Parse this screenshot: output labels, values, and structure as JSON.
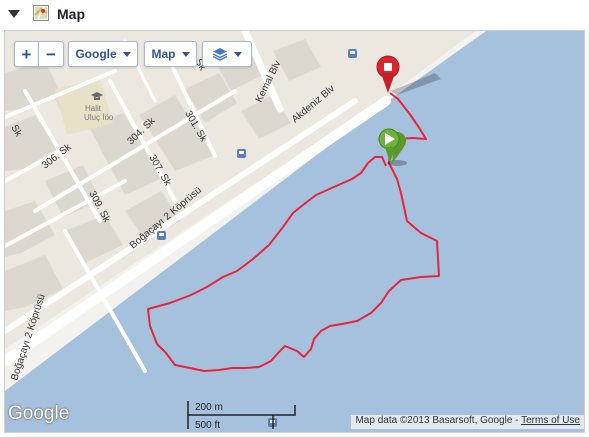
{
  "header": {
    "title": "Map",
    "collapse_icon": "triangle-down-icon",
    "app_icon": "map-icon"
  },
  "controls": {
    "zoom_in": "+",
    "zoom_out": "−",
    "provider": "Google",
    "map_type": "Map",
    "layers_icon": "layers-icon"
  },
  "map": {
    "streets": [
      "Kemal Blv",
      "Akdeniz Blv",
      "Boğaçayı 2 Köprüsü",
      "Boğaçayı 2 Köprüsü",
      "306. Sk",
      "304. Sk",
      "301. Sk",
      "307. Sk",
      "309. Sk",
      "Sk",
      "Sk"
    ],
    "poi": [
      "Halit",
      "Uluç İöo"
    ],
    "start_marker": "play-marker-icon",
    "end_marker": "stop-marker-icon",
    "route_color": "#e8243a",
    "water_color": "#a6c1dd",
    "land_color": "#ece8e0",
    "road_color": "#ffffff",
    "block_color": "#dcd8d0"
  },
  "footer": {
    "logo": "Google",
    "scale_metric": "200 m",
    "scale_imperial": "500 ft",
    "attribution": "Map data ©2013 Basarsoft, Google - ",
    "terms": "Terms of Use"
  }
}
